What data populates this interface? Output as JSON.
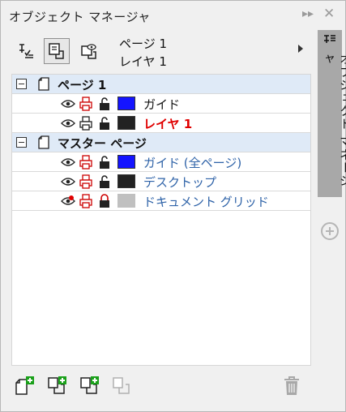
{
  "panel": {
    "title": "オブジェクト マネージャ"
  },
  "toolbar": {
    "page_line": "ページ 1",
    "layer_line": "レイヤ 1",
    "buttons": [
      "show-object-properties-icon",
      "edit-across-layers-icon",
      "layer-manager-view-icon"
    ]
  },
  "tree": {
    "pages": [
      {
        "label": "ページ 1",
        "layers": [
          {
            "label": "ガイド",
            "color": "#1414ff",
            "active": false
          },
          {
            "label": "レイヤ 1",
            "color": "#222222",
            "active": true
          }
        ]
      }
    ],
    "master": {
      "label": "マスター ページ",
      "layers": [
        {
          "label": "ガイド (全ページ)",
          "color": "#1414ff"
        },
        {
          "label": "デスクトップ",
          "color": "#222222"
        },
        {
          "label": "ドキュメント グリッド",
          "color": "#c0c0c0"
        }
      ]
    }
  },
  "bottom": {
    "buttons": [
      "new-layer-icon",
      "new-master-layer-all-pages-icon",
      "new-master-layer-odd-icon",
      "new-master-layer-even-icon",
      "delete-icon"
    ]
  },
  "sidetab": {
    "label": "オブジェクト マネージャ"
  },
  "colors": {
    "header_bg": "#dfeaf7",
    "active_layer": "#e00000",
    "master_layer": "#2f63a8"
  }
}
